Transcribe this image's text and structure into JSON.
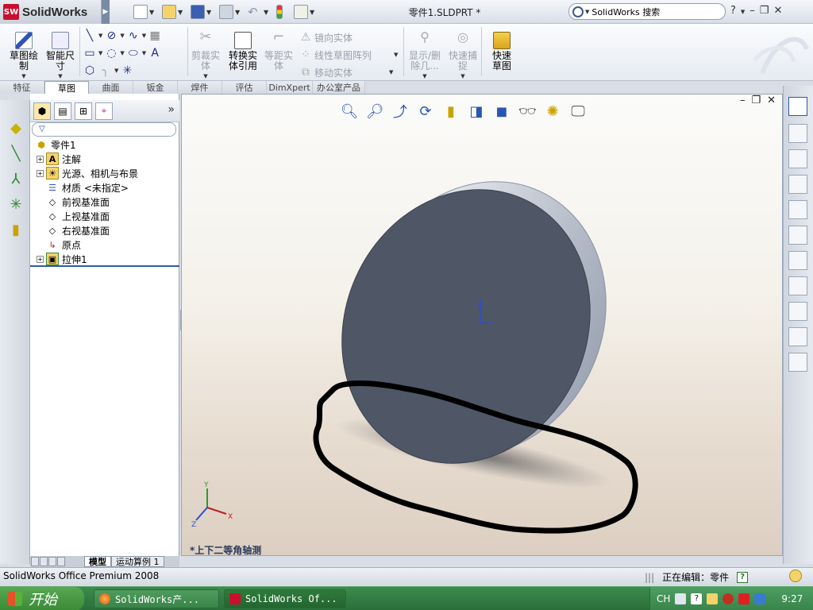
{
  "app": {
    "logo": "SolidWorks",
    "logo_badge": "SW",
    "doc_title": "零件1.SLDPRT *",
    "search_placeholder": "SolidWorks 搜索",
    "window_controls": [
      "?",
      "–",
      "❐",
      "✕"
    ]
  },
  "ribbon": {
    "sketch_label": "草图绘制",
    "smart_dim_label": "智能尺寸",
    "trim_label": "剪裁实体",
    "convert_label": "转换实体引用",
    "offset_label": "等距实体",
    "mirror_label": "镜向实体",
    "linear_pattern_label": "线性草图阵列",
    "move_label": "移动实体",
    "show_delete_label": "显示/删除几...",
    "quick_snap_label": "快速捕捉",
    "rapid_sketch_label": "快速草图"
  },
  "command_tabs": [
    "特征",
    "草图",
    "曲面",
    "钣金",
    "焊件",
    "评估",
    "DimXpert",
    "办公室产品"
  ],
  "active_command_tab": "草图",
  "tree": {
    "root": "零件1",
    "items": [
      {
        "label": "注解",
        "icon": "annotation-icon",
        "expandable": true
      },
      {
        "label": "光源、相机与布景",
        "icon": "lights-icon",
        "expandable": true
      },
      {
        "label": "材质 <未指定>",
        "icon": "material-icon",
        "expandable": false
      },
      {
        "label": "前视基准面",
        "icon": "plane-icon",
        "expandable": false
      },
      {
        "label": "上视基准面",
        "icon": "plane-icon",
        "expandable": false
      },
      {
        "label": "右视基准面",
        "icon": "plane-icon",
        "expandable": false
      },
      {
        "label": "原点",
        "icon": "origin-icon",
        "expandable": false
      },
      {
        "label": "拉伸1",
        "icon": "extrude-icon",
        "expandable": true
      }
    ],
    "expand_symbol": "»"
  },
  "bottom_tabs": [
    "模型",
    "运动算例 1"
  ],
  "active_bottom_tab": "模型",
  "viewport": {
    "view_name": "*上下二等角轴测",
    "triad": {
      "x": "X",
      "y": "Y",
      "z": "Z"
    },
    "controls": [
      "–",
      "❐",
      "✕"
    ]
  },
  "status": {
    "product": "SolidWorks Office Premium 2008",
    "editing": "正在编辑：零件"
  },
  "taskbar": {
    "start_label": "开始",
    "tasks": [
      "SolidWorks产...",
      "SolidWorks Of..."
    ],
    "tray_lang": "CH",
    "clock": "9:27"
  },
  "colors": {
    "part_face": "#4f5766",
    "part_edge": "#c5ccd9",
    "annotation_stroke": "#000000",
    "ribbon_icon": "#1c2b8a",
    "taskbar": "#2f7a3c"
  }
}
